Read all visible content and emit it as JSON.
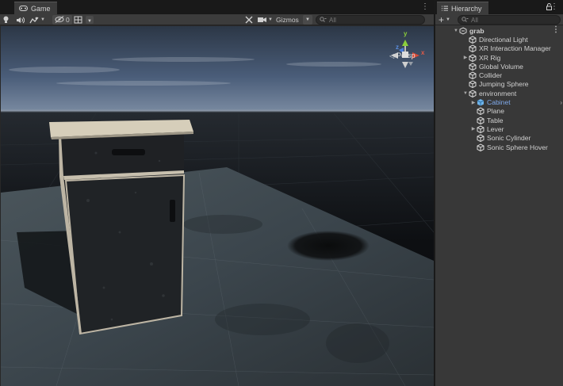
{
  "game": {
    "tab_label": "Game",
    "toolbar": {
      "visibility_count": "0",
      "gizmos_label": "Gizmos",
      "search_placeholder": "All"
    },
    "viewport": {
      "persp_label": "Persp",
      "gizmo_axes": {
        "x": "x",
        "y": "y",
        "z": "z"
      }
    }
  },
  "hierarchy": {
    "tab_label": "Hierarchy",
    "add_label": "+",
    "search_placeholder": "All",
    "items": [
      {
        "label": "grab",
        "expanded": true,
        "root": true
      },
      {
        "label": "Directional Light"
      },
      {
        "label": "XR Interaction Manager"
      },
      {
        "label": "XR Rig",
        "has_children": true
      },
      {
        "label": "Global Volume"
      },
      {
        "label": "Collider"
      },
      {
        "label": "Jumping Sphere"
      },
      {
        "label": "environment",
        "expanded": true
      },
      {
        "label": "Cabinet",
        "has_children": true,
        "highlighted": true
      },
      {
        "label": "Plane"
      },
      {
        "label": "Table"
      },
      {
        "label": "Lever",
        "has_children": true
      },
      {
        "label": "Sonic Cylinder"
      },
      {
        "label": "Sonic Sphere Hover"
      }
    ]
  },
  "colors": {
    "panel_bg": "#383838",
    "toolbar_bg": "#3c3c3c",
    "highlight_text": "#7fa9ea",
    "sky_top": "#2b3545",
    "floor": "#3a444b"
  }
}
